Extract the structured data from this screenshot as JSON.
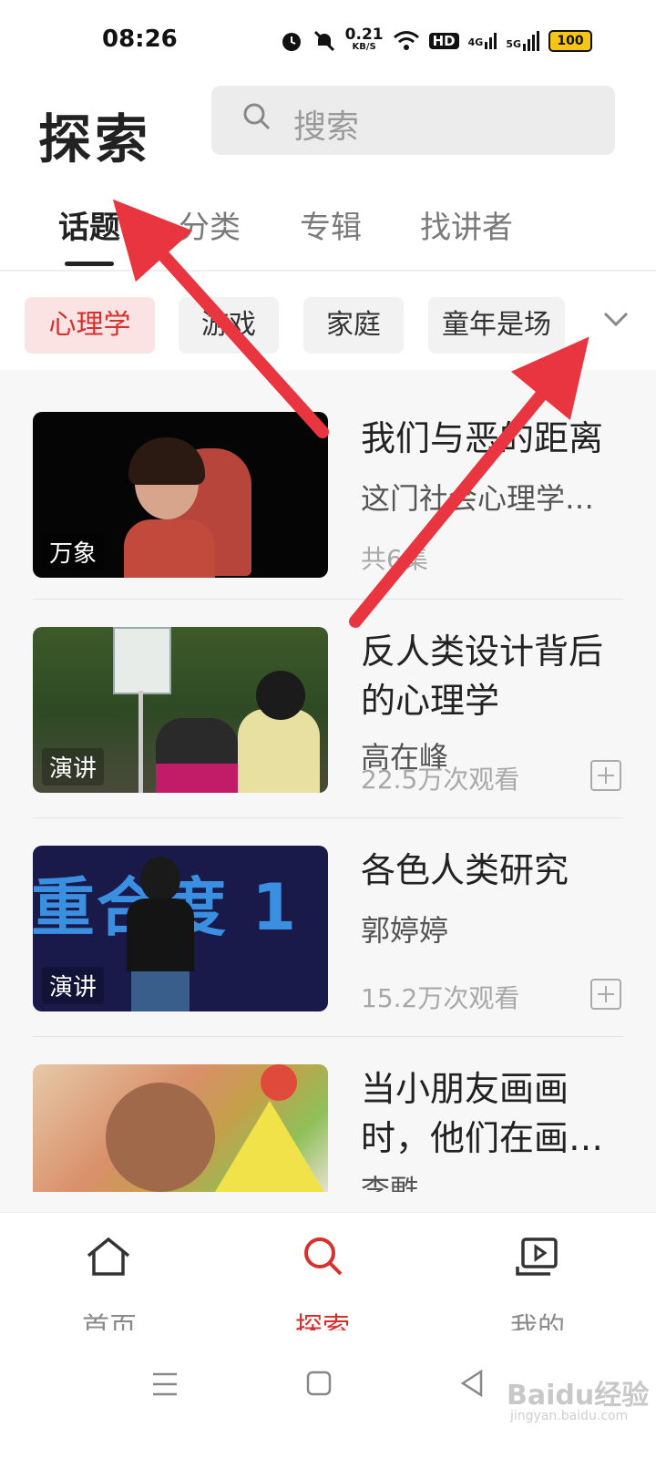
{
  "status_bar": {
    "time": "08:26",
    "net_speed_value": "0.21",
    "net_speed_unit": "KB/S",
    "hd_label": "HD",
    "signal_1": "4G",
    "signal_2": "5G",
    "battery": "100",
    "icons": [
      "alarm-icon",
      "mute-icon",
      "wifi-icon",
      "hd-icon",
      "signal-4g-icon",
      "signal-5g-icon",
      "battery-icon"
    ]
  },
  "header": {
    "title": "探索",
    "search_placeholder": "搜索"
  },
  "tabs": [
    {
      "label": "话题",
      "active": true
    },
    {
      "label": "分类",
      "active": false
    },
    {
      "label": "专辑",
      "active": false
    },
    {
      "label": "找讲者",
      "active": false
    }
  ],
  "chips": [
    {
      "label": "心理学",
      "active": true
    },
    {
      "label": "游戏",
      "active": false
    },
    {
      "label": "家庭",
      "active": false
    },
    {
      "label": "童年是场",
      "active": false
    }
  ],
  "items": [
    {
      "badge": "万象",
      "title": "我们与恶的距离",
      "subtitle": "这门社会心理学…",
      "meta": "共6集"
    },
    {
      "badge": "演讲",
      "title": "反人类设计背后的心理学",
      "subtitle": "高在峰",
      "meta": "22.5万次观看"
    },
    {
      "badge": "演讲",
      "title": "各色人类研究",
      "subtitle": "郭婷婷",
      "meta": "15.2万次观看"
    },
    {
      "badge": "",
      "title": "当小朋友画画时，他们在画…",
      "subtitle": "李甦",
      "meta": ""
    }
  ],
  "thumb_text": {
    "item3_bg_text": "重合度 1"
  },
  "bottom_nav": [
    {
      "label": "首页",
      "icon": "home-icon",
      "active": false
    },
    {
      "label": "探索",
      "icon": "search-icon",
      "active": true
    },
    {
      "label": "我的",
      "icon": "profile-video-icon",
      "active": false
    }
  ],
  "watermark": {
    "brand": "Baidu经验",
    "url": "jingyan.baidu.com"
  },
  "colors": {
    "accent": "#d8302c",
    "arrow": "#e8353f",
    "chip_active_bg": "#fbe3e3"
  }
}
